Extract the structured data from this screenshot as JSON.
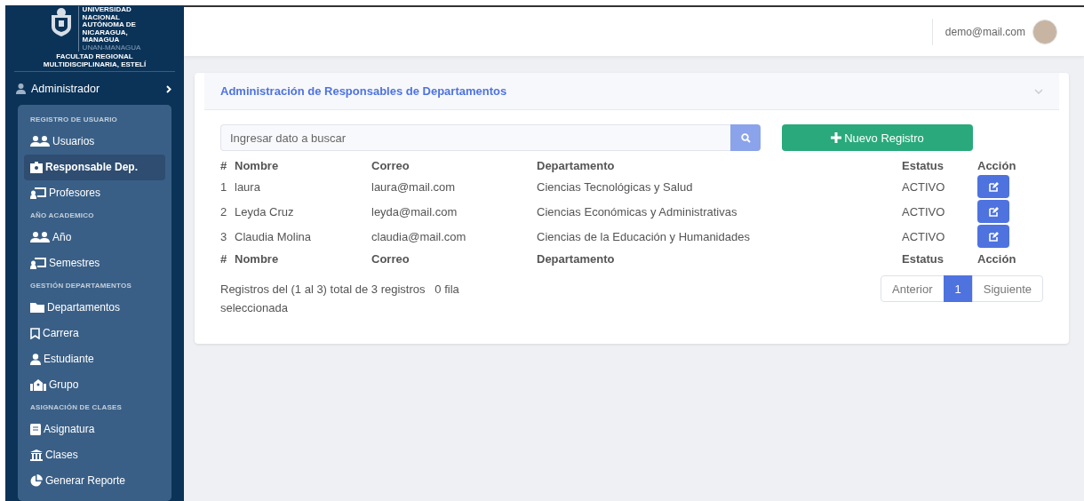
{
  "sidebar": {
    "logo": {
      "lines": [
        "UNIVERSIDAD",
        "NACIONAL",
        "AUTÓNOMA DE",
        "NICARAGUA,",
        "MANAGUA"
      ],
      "tagline": "UNAN-MANAGUA",
      "faculty": "FACULTAD REGIONAL MULTIDISCIPLINARIA, ESTELÍ"
    },
    "user": {
      "label": "Administrador",
      "expanded": false
    },
    "items": [
      {
        "kind": "section",
        "label": "REGISTRO DE USUARIO"
      },
      {
        "kind": "link",
        "label": "Usuarios",
        "selected": false
      },
      {
        "kind": "link",
        "label": "Responsable Dep.",
        "selected": true
      },
      {
        "kind": "link",
        "label": "Profesores",
        "selected": false
      },
      {
        "kind": "section",
        "label": "AÑO ACADEMICO"
      },
      {
        "kind": "link",
        "label": "Año",
        "selected": false
      },
      {
        "kind": "link",
        "label": "Semestres",
        "selected": false
      },
      {
        "kind": "section",
        "label": "GESTIÓN DEPARTAMENTOS"
      },
      {
        "kind": "link",
        "label": "Departamentos",
        "selected": false
      },
      {
        "kind": "link",
        "label": "Carrera",
        "selected": false
      },
      {
        "kind": "link",
        "label": "Estudiante",
        "selected": false
      },
      {
        "kind": "link",
        "label": "Grupo",
        "selected": false
      },
      {
        "kind": "section",
        "label": "ASIGNACIÓN DE CLASES"
      },
      {
        "kind": "link",
        "label": "Asignatura",
        "selected": false
      },
      {
        "kind": "link",
        "label": "Clases",
        "selected": false
      },
      {
        "kind": "link",
        "label": "Generar Reporte",
        "selected": false
      }
    ]
  },
  "topbar": {
    "user_email": "demo@mail.com"
  },
  "card": {
    "title": "Administración de Responsables de Departamentos",
    "expanded": true,
    "search": {
      "placeholder": "Ingresar dato a buscar"
    },
    "new_button": "Nuevo Registro",
    "table": {
      "columns": [
        "#",
        "Nombre",
        "Correo",
        "Departamento",
        "Estatus",
        "Acción"
      ],
      "rows": [
        [
          "1",
          "laura",
          "laura@mail.com",
          "Ciencias Tecnológicas y Salud",
          "ACTIVO"
        ],
        [
          "2",
          "Leyda Cruz",
          "leyda@mail.com",
          "Ciencias Económicas y Administrativas",
          "ACTIVO"
        ],
        [
          "3",
          "Claudia Molina",
          "claudia@mail.com",
          "Ciencias de la Educación y Humanidades",
          "ACTIVO"
        ]
      ],
      "footer_columns": [
        "#",
        "Nombre",
        "Correo",
        "Departamento",
        "Estatus",
        "Acción"
      ]
    },
    "info": "Registros del (1 al 3) total de 3 registros",
    "selection_info": "0 fila seleccionada",
    "pagination": [
      {
        "label": "Anterior",
        "selected": false
      },
      {
        "label": "1",
        "selected": true
      },
      {
        "label": "Siguiente",
        "selected": false
      }
    ]
  }
}
